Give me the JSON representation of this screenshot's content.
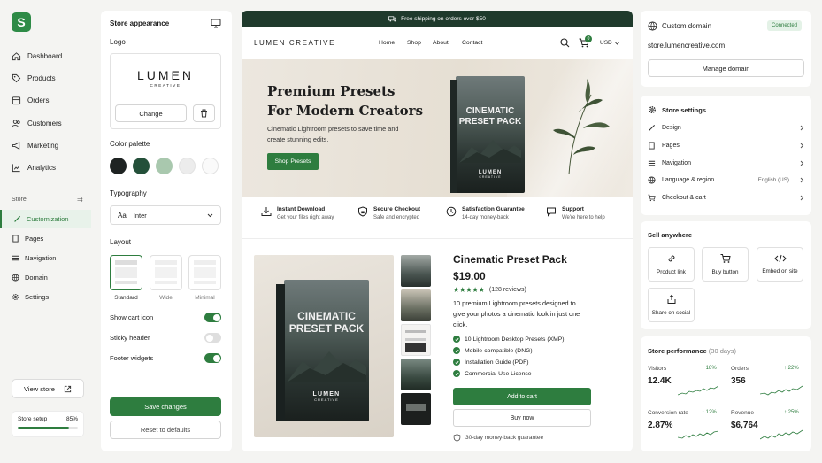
{
  "nav": {
    "logo_letter": "S",
    "items": [
      {
        "label": "Dashboard",
        "icon": "home-icon"
      },
      {
        "label": "Products",
        "icon": "tag-icon"
      },
      {
        "label": "Orders",
        "icon": "box-icon"
      },
      {
        "label": "Customers",
        "icon": "users-icon"
      },
      {
        "label": "Marketing",
        "icon": "megaphone-icon"
      },
      {
        "label": "Analytics",
        "icon": "chart-icon"
      }
    ],
    "store_label": "Store",
    "store_items": [
      {
        "label": "Customization",
        "icon": "brush-icon",
        "active": true
      },
      {
        "label": "Pages",
        "icon": "page-icon"
      },
      {
        "label": "Navigation",
        "icon": "menu-icon"
      },
      {
        "label": "Domain",
        "icon": "globe-icon"
      },
      {
        "label": "Settings",
        "icon": "gear-icon"
      }
    ],
    "view_store": "View store",
    "setup_label": "Store setup",
    "setup_pct_text": "85%",
    "setup_progress": 0.85
  },
  "appearance": {
    "title": "Store appearance",
    "logo_label": "Logo",
    "logo_word": "LUMEN",
    "logo_sub": "CREATIVE",
    "change_btn": "Change",
    "palette_label": "Color palette",
    "palette": [
      "#1e2322",
      "#24503a",
      "#a9c8ae",
      "#ececec",
      "#fafafa"
    ],
    "typography_label": "Typography",
    "font_prefix": "Aa",
    "font_name": "Inter",
    "layout_label": "Layout",
    "layouts": [
      "Standard",
      "Wide",
      "Minimal"
    ],
    "toggles": [
      {
        "label": "Show cart icon",
        "on": true
      },
      {
        "label": "Sticky header",
        "on": false
      },
      {
        "label": "Footer widgets",
        "on": true
      }
    ],
    "save_btn": "Save changes",
    "reset_btn": "Reset to defaults"
  },
  "preview": {
    "banner": "Free shipping on orders over $50",
    "brand": "LUMEN CREATIVE",
    "menu": [
      "Home",
      "Shop",
      "About",
      "Contact"
    ],
    "cart_count": "0",
    "currency": "USD",
    "hero_title_1": "Premium Presets",
    "hero_title_2": "For Modern Creators",
    "hero_text": "Cinematic Lightroom presets to save time and create stunning edits.",
    "hero_btn": "Shop Presets",
    "box_title_1": "CINEMATIC",
    "box_title_2": "PRESET PACK",
    "box_brand": "LUMEN",
    "box_brand_sub": "CREATIVE",
    "features": [
      {
        "title": "Instant Download",
        "sub": "Get your files right away",
        "icon": "download-icon"
      },
      {
        "title": "Secure Checkout",
        "sub": "Safe and encrypted",
        "icon": "shield-icon"
      },
      {
        "title": "Satisfaction Guarantee",
        "sub": "14-day money-back",
        "icon": "clock-icon"
      },
      {
        "title": "Support",
        "sub": "We're here to help",
        "icon": "chat-icon"
      }
    ],
    "product": {
      "title": "Cinematic Preset Pack",
      "price": "$19.00",
      "rating": 5,
      "reviews": "(128 reviews)",
      "desc": "10 premium Lightroom presets designed to give your photos a cinematic look in just one click.",
      "features": [
        "10 Lightroom Desktop Presets (XMP)",
        "Mobile-compatible (DNG)",
        "Installation Guide (PDF)",
        "Commercial Use License"
      ],
      "add_btn": "Add to cart",
      "buy_btn": "Buy now",
      "guarantee": "30-day money-back guarantee"
    }
  },
  "domain": {
    "title": "Custom domain",
    "status": "Connected",
    "url": "store.lumencreative.com",
    "manage_btn": "Manage domain"
  },
  "settings": {
    "title": "Store settings",
    "items": [
      {
        "label": "Design",
        "icon": "brush-icon",
        "value": ""
      },
      {
        "label": "Pages",
        "icon": "page-icon",
        "value": ""
      },
      {
        "label": "Navigation",
        "icon": "menu-icon",
        "value": ""
      },
      {
        "label": "Language & region",
        "icon": "globe-icon",
        "value": "English (US)"
      },
      {
        "label": "Checkout & cart",
        "icon": "cart-icon",
        "value": ""
      }
    ]
  },
  "sell": {
    "title": "Sell anywhere",
    "options": [
      {
        "label": "Product link",
        "icon": "link-icon"
      },
      {
        "label": "Buy button",
        "icon": "cart-icon"
      },
      {
        "label": "Embed on site",
        "icon": "code-icon"
      },
      {
        "label": "Share on social",
        "icon": "share-icon"
      }
    ]
  },
  "performance": {
    "title": "Store performance",
    "period": "(30 days)",
    "metrics": [
      {
        "label": "Visitors",
        "value": "12.4K",
        "change": "18%"
      },
      {
        "label": "Orders",
        "value": "356",
        "change": "22%"
      },
      {
        "label": "Conversion rate",
        "value": "2.87%",
        "change": "12%"
      },
      {
        "label": "Revenue",
        "value": "$6,764",
        "change": "25%"
      }
    ]
  },
  "colors": {
    "accent": "#2e7d3f",
    "banner": "#1f3a2c"
  }
}
